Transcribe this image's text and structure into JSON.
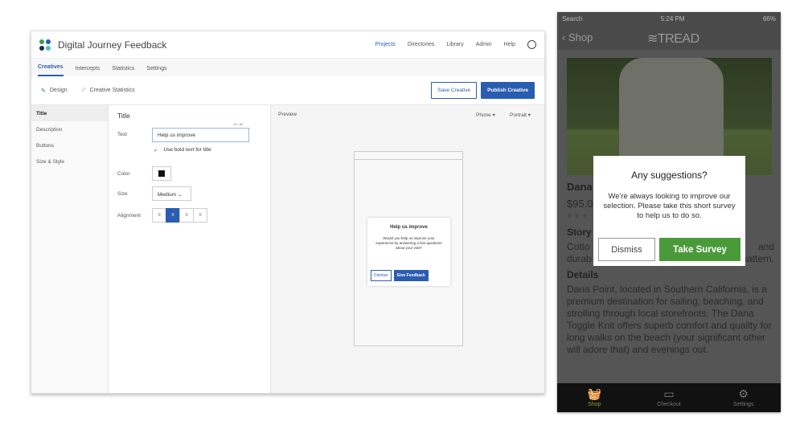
{
  "app": {
    "title": "Digital Journey Feedback",
    "logo_colors": [
      "#3a9b5c",
      "#2a5db0",
      "#1e2a5a",
      "#4cc3c3"
    ],
    "nav": [
      "Projects",
      "Directories",
      "Library",
      "Admin",
      "Help"
    ],
    "active_nav": "Projects",
    "tabs": [
      "Creatives",
      "Intercepts",
      "Statistics",
      "Settings"
    ],
    "active_tab": "Creatives",
    "toolbar": {
      "design": "Design",
      "stats": "Creative Statistics",
      "save": "Save Creative",
      "publish": "Publish Creative"
    },
    "sidebar": [
      "Title",
      "Description",
      "Buttons",
      "Size & Style"
    ],
    "form": {
      "heading": "Title",
      "text_label": "Text",
      "text_value": "Help us improve",
      "counter": "15 / 80",
      "bold_label": "Use bold text for title",
      "bold_checked": true,
      "color_label": "Color",
      "color_value": "#111111",
      "size_label": "Size",
      "size_value": "Medium",
      "alignment_label": "Alignment",
      "alignment_selected": "center"
    },
    "preview": {
      "label": "Preview",
      "device": "Phone",
      "orientation": "Portrait",
      "modal": {
        "title": "Help us improve",
        "body": "Would you help us improve your experience by answering a few questions about your visit?",
        "dismiss": "Dismiss",
        "give": "Give Feedback"
      }
    },
    "accent": "#2a5db0"
  },
  "phone": {
    "status": {
      "left": "Search",
      "time": "5:24 PM",
      "battery": "66%"
    },
    "back": "Shop",
    "brand": "TREAD",
    "product_name": "Dana",
    "price": "$95.0",
    "story_h": "Story",
    "story_l1a": "Cotto",
    "story_l1b": "and",
    "story_l2a": "durab",
    "story_l2b": "pattern.",
    "details_h": "Details",
    "details": "Dana Point, located in Southern California, is a premium destination for sailing, beaching, and strolling through local storefronts. The Dana Toggle Knit offers superb comfort and quality for long walks on the beach (your significant other will adore that) and evenings out.",
    "modal": {
      "title": "Any suggestions?",
      "body": "We're always looking to improve our selection. Please take this short survey to help us  to do so.",
      "dismiss": "Dismiss",
      "take": "Take Survey",
      "take_color": "#4a9a3a"
    },
    "tabs": [
      "Shop",
      "Checkout",
      "Settings"
    ],
    "active_tab": "Shop"
  }
}
